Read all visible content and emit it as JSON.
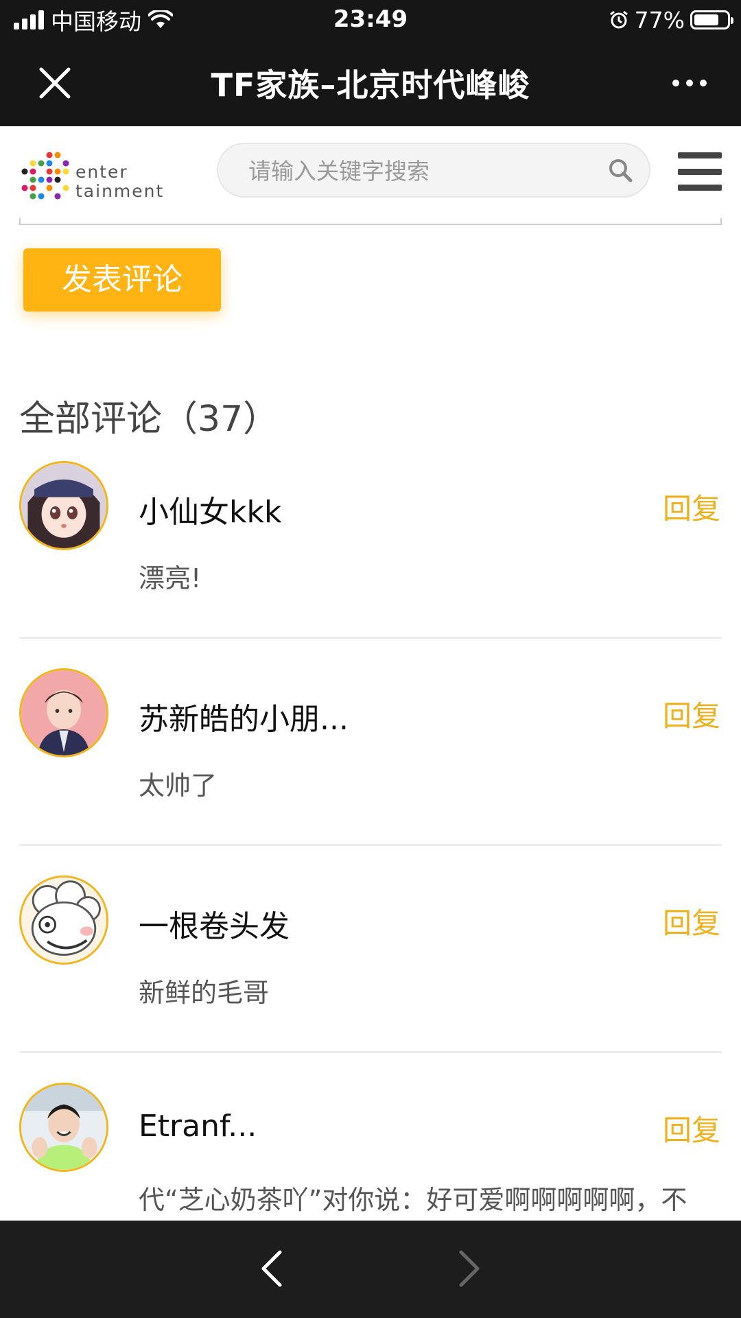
{
  "status_bar": {
    "carrier": "中国移动",
    "time": "23:49",
    "battery": "77%",
    "battery_level": 0.77
  },
  "nav": {
    "title": "TF家族–北京时代峰峻"
  },
  "header": {
    "logo_line1": "enter",
    "logo_line2": "tainment",
    "search_placeholder": "请输入关键字搜索"
  },
  "post_button": "发表评论",
  "comments_heading": "全部评论（37）",
  "comments": [
    {
      "name": "小仙女kkk",
      "text": "漂亮!",
      "reply": "回复",
      "avatar": "anime-girl-avatar"
    },
    {
      "name": "苏新皓的小朋...",
      "text": "太帅了",
      "reply": "回复",
      "avatar": "boy-suit-avatar"
    },
    {
      "name": "一根卷头发",
      "text": "新鲜的毛哥",
      "reply": "回复",
      "avatar": "cartoon-sheep-avatar"
    },
    {
      "name": "Etranf...",
      "text": "代“芝心奶茶吖”对你说：好可爱啊啊啊啊啊，不",
      "reply": "回复",
      "avatar": "boy-clapping-avatar"
    }
  ],
  "colors": {
    "accent": "#ffb414",
    "reply": "#efb01d",
    "avatar_border": "#f3b51e",
    "dark_bar": "#161616"
  }
}
